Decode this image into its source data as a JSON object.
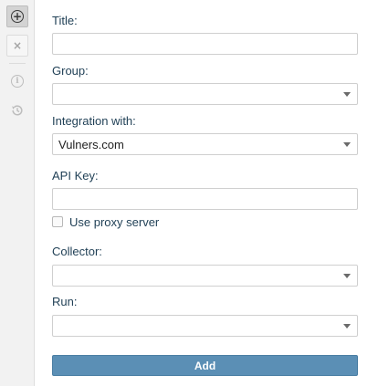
{
  "toolbar": {
    "add_icon": "plus-circle-icon",
    "close_icon": "close-icon",
    "info_icon": "info-icon",
    "history_icon": "history-icon"
  },
  "form": {
    "title_label": "Title:",
    "title_value": "",
    "group_label": "Group:",
    "group_value": "",
    "integration_label": "Integration with:",
    "integration_value": "Vulners.com",
    "api_key_label": "API Key:",
    "api_key_value": "",
    "use_proxy_label": "Use proxy server",
    "use_proxy_checked": false,
    "collector_label": "Collector:",
    "collector_value": "",
    "run_label": "Run:",
    "run_value": "",
    "add_button_label": "Add"
  },
  "colors": {
    "label_text": "#1f3f55",
    "button_bg": "#5b8fb5",
    "rail_bg": "#f2f2f2"
  }
}
